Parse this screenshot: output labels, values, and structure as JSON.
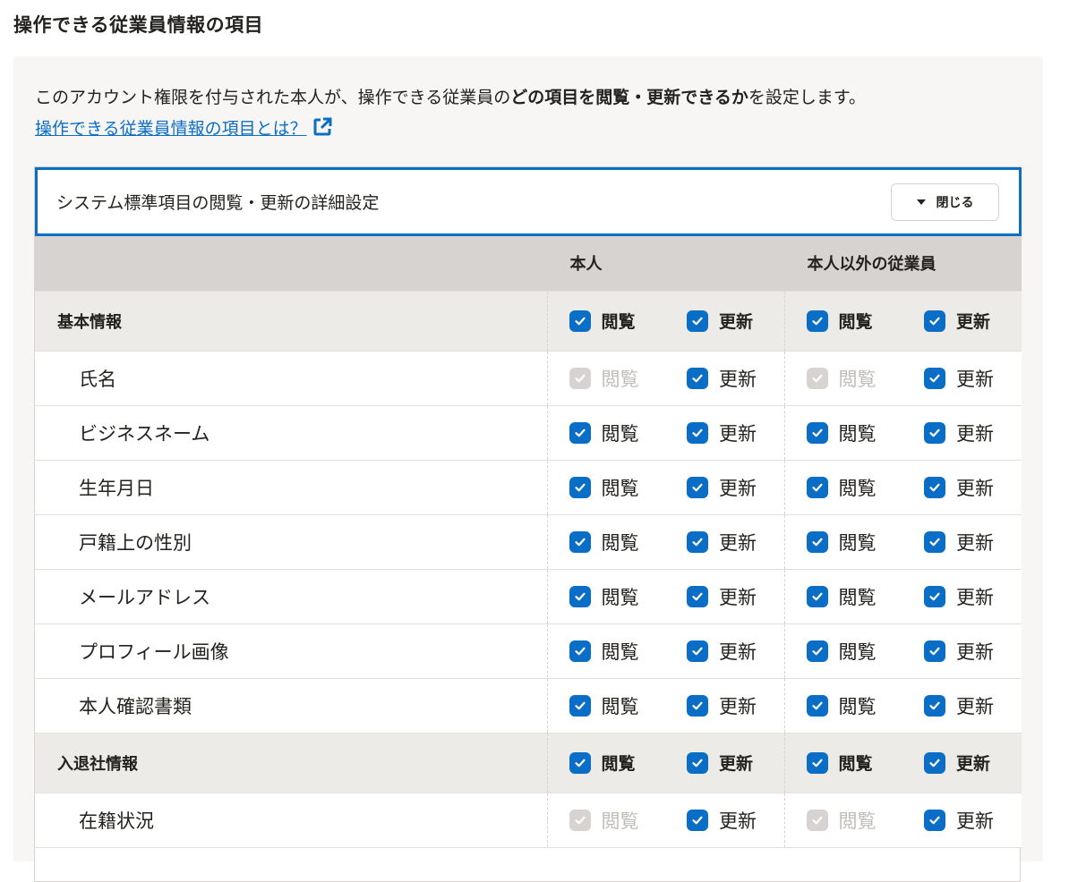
{
  "page_title": "操作できる従業員情報の項目",
  "description": {
    "prefix": "このアカウント権限を付与された本人が、操作できる従業員の",
    "emphasis": "どの項目を閲覧・更新できるか",
    "suffix": "を設定します。"
  },
  "help_link": "操作できる従業員情報の項目とは？",
  "colors": {
    "accent": "#0b6ec6",
    "disabled": "#d6d3d0",
    "header_bg": "#d6d3d0",
    "group_bg": "#edebe8"
  },
  "card": {
    "title": "システム標準項目の閲覧・更新の詳細設定",
    "close_button": "閉じる"
  },
  "columns": {
    "self": "本人",
    "others": "本人以外の従業員"
  },
  "labels": {
    "view": "閲覧",
    "update": "更新"
  },
  "rows": [
    {
      "type": "group",
      "label": "基本情報",
      "self_view": "checked",
      "self_update": "checked",
      "other_view": "checked",
      "other_update": "checked"
    },
    {
      "type": "item",
      "label": "氏名",
      "self_view": "disabled",
      "self_update": "checked",
      "other_view": "disabled",
      "other_update": "checked"
    },
    {
      "type": "item",
      "label": "ビジネスネーム",
      "self_view": "checked",
      "self_update": "checked",
      "other_view": "checked",
      "other_update": "checked"
    },
    {
      "type": "item",
      "label": "生年月日",
      "self_view": "checked",
      "self_update": "checked",
      "other_view": "checked",
      "other_update": "checked"
    },
    {
      "type": "item",
      "label": "戸籍上の性別",
      "self_view": "checked",
      "self_update": "checked",
      "other_view": "checked",
      "other_update": "checked"
    },
    {
      "type": "item",
      "label": "メールアドレス",
      "self_view": "checked",
      "self_update": "checked",
      "other_view": "checked",
      "other_update": "checked"
    },
    {
      "type": "item",
      "label": "プロフィール画像",
      "self_view": "checked",
      "self_update": "checked",
      "other_view": "checked",
      "other_update": "checked"
    },
    {
      "type": "item",
      "label": "本人確認書類",
      "self_view": "checked",
      "self_update": "checked",
      "other_view": "checked",
      "other_update": "checked"
    },
    {
      "type": "group",
      "label": "入退社情報",
      "self_view": "checked",
      "self_update": "checked",
      "other_view": "checked",
      "other_update": "checked"
    },
    {
      "type": "item",
      "label": "在籍状況",
      "self_view": "disabled",
      "self_update": "checked",
      "other_view": "disabled",
      "other_update": "checked"
    }
  ]
}
